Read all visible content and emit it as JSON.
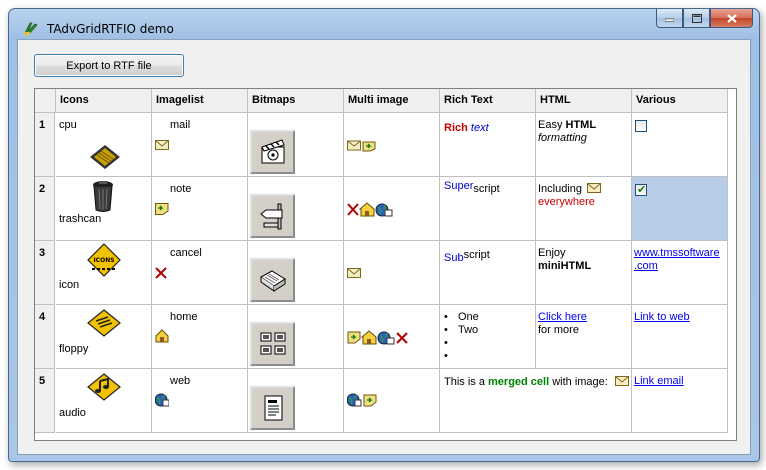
{
  "window": {
    "title": "TAdvGridRTFIO demo"
  },
  "toolbar": {
    "export_label": "Export to RTF file"
  },
  "grid": {
    "headers": [
      "Icons",
      "Imagelist",
      "Bitmaps",
      "Multi image",
      "Rich Text",
      "HTML",
      "Various"
    ],
    "rows": [
      {
        "num": "1",
        "icon_label": "cpu",
        "imagelist": "mail",
        "rich": {
          "part1": "Rich",
          "part2": "text"
        },
        "html": {
          "line1_pre": "Easy ",
          "line1_bold": "HTML",
          "line2": "formatting"
        },
        "various": {
          "type": "checkbox",
          "checked": false
        }
      },
      {
        "num": "2",
        "icon_label": "trashcan",
        "imagelist": "note",
        "rich": {
          "part1": "Super",
          "part2": "script"
        },
        "html": {
          "line1_pre": "Including",
          "line2": "everywhere"
        },
        "various": {
          "type": "checkbox",
          "checked": true
        }
      },
      {
        "num": "3",
        "icon_label": "icon",
        "imagelist": "cancel",
        "rich": {
          "part1": "Sub",
          "part2": "script"
        },
        "html": {
          "line1_pre": "Enjoy",
          "line2": "miniHTML"
        },
        "various": {
          "type": "link",
          "text1": "www.tmssoftware",
          "text2": ".com"
        }
      },
      {
        "num": "4",
        "icon_label": "floppy",
        "imagelist": "home",
        "rich": {
          "bullets": [
            "One",
            "Two",
            "",
            ""
          ]
        },
        "html": {
          "link": "Click here",
          "line2": "for more"
        },
        "various": {
          "type": "link",
          "text1": "Link to web"
        }
      },
      {
        "num": "5",
        "icon_label": "audio",
        "imagelist": "web",
        "merged": {
          "pre": "This is a ",
          "bold": "merged cell",
          "post": " with image:"
        },
        "various": {
          "type": "link",
          "text1": "Link email"
        }
      }
    ]
  },
  "colors": {
    "selected_cell": "#b8cde8",
    "rich_red": "#cc0000",
    "rich_blue": "#0000cc",
    "merged_green": "#008000"
  }
}
